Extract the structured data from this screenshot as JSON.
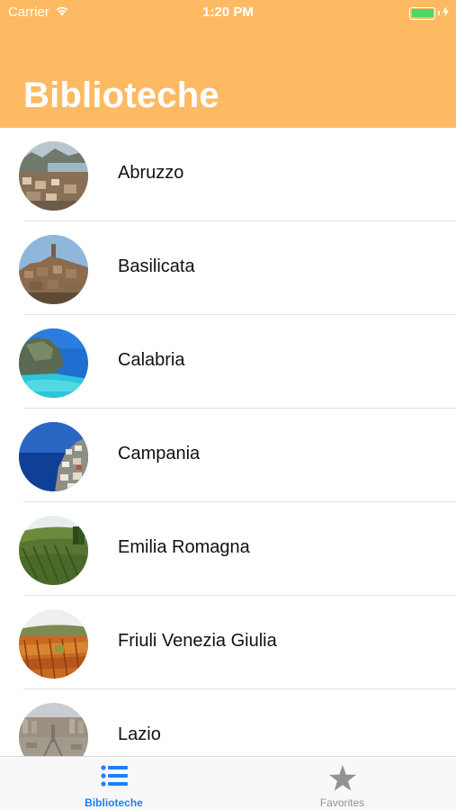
{
  "status_bar": {
    "carrier": "Carrier",
    "time": "1:20 PM",
    "battery_color": "#4CD964"
  },
  "header": {
    "title": "Biblioteche",
    "background": "#FEBA63"
  },
  "regions": [
    {
      "name": "Abruzzo",
      "thumb": "coastal-town-photo"
    },
    {
      "name": "Basilicata",
      "thumb": "hilltop-village-photo"
    },
    {
      "name": "Calabria",
      "thumb": "turquoise-sea-cliff-photo"
    },
    {
      "name": "Campania",
      "thumb": "amalfi-coast-photo"
    },
    {
      "name": "Emilia Romagna",
      "thumb": "vineyard-hills-photo"
    },
    {
      "name": "Friuli Venezia Giulia",
      "thumb": "autumn-vineyard-photo"
    },
    {
      "name": "Lazio",
      "thumb": "rome-square-photo"
    }
  ],
  "tabbar": {
    "tabs": [
      {
        "label": "Biblioteche",
        "icon": "list-icon",
        "active": true,
        "color": "#1A82F7"
      },
      {
        "label": "Favorites",
        "icon": "star-icon",
        "active": false,
        "color": "#929292"
      }
    ]
  }
}
